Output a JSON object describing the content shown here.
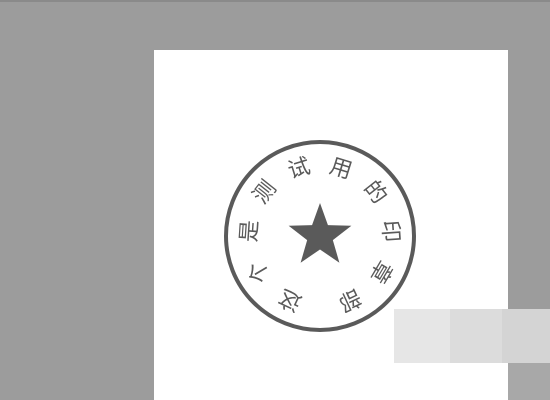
{
  "seal": {
    "text": "这个是测试用的印章部",
    "star": "★",
    "color": "#5a5a5a"
  },
  "colors": {
    "workspace": "#9c9c9c",
    "canvas": "#ffffff"
  }
}
